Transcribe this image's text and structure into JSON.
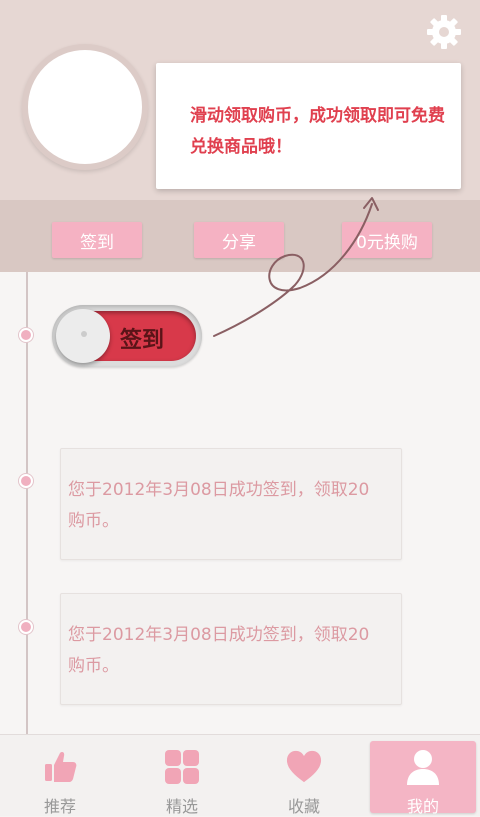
{
  "header": {
    "settings_icon": "gear-icon",
    "tip": "滑动领取购币，成功领取即可免费兑换商品哦！"
  },
  "actions": [
    {
      "label": "签到"
    },
    {
      "label": "分享"
    },
    {
      "label": "0元换购"
    }
  ],
  "checkin_toggle": {
    "label": "签到",
    "state": "off"
  },
  "records": [
    {
      "text": "您于2012年3月08日成功签到，领取20购币。"
    },
    {
      "text": "您于2012年3月08日成功签到，领取20购币。"
    }
  ],
  "tabbar": {
    "items": [
      {
        "label": "推荐",
        "icon": "thumbs-up-icon"
      },
      {
        "label": "精选",
        "icon": "grid-icon"
      },
      {
        "label": "收藏",
        "icon": "heart-icon"
      },
      {
        "label": "我的",
        "icon": "user-icon"
      }
    ],
    "active_index": 3
  },
  "colors": {
    "accent": "#f4b5c5",
    "tip_text": "#e0404f",
    "toggle_red": "#d8394a",
    "record_text": "#dc9aa2"
  }
}
